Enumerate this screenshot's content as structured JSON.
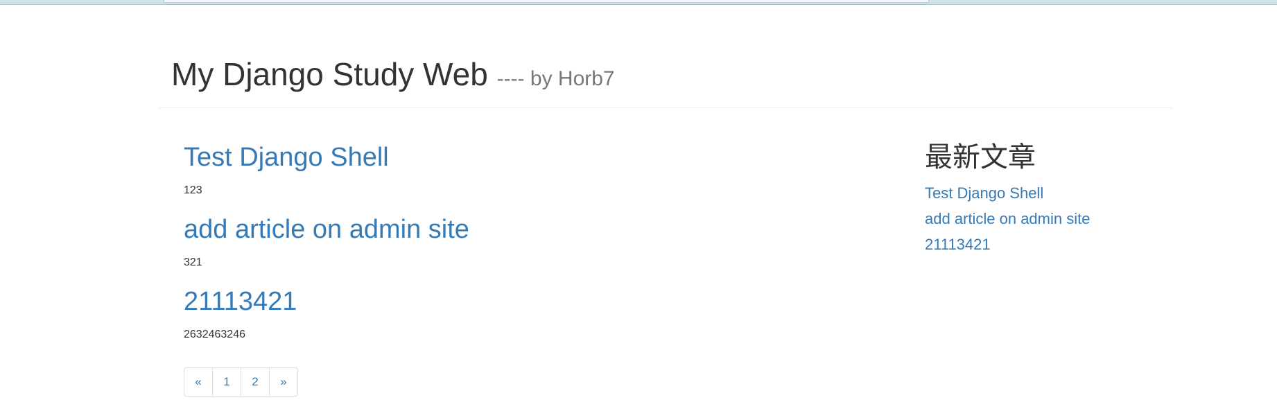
{
  "header": {
    "title": "My Django Study Web",
    "subtitle": "---- by Horb7"
  },
  "articles": [
    {
      "title": "Test Django Shell",
      "body": "123"
    },
    {
      "title": "add article on admin site",
      "body": "321"
    },
    {
      "title": "21113421",
      "body": "2632463246"
    }
  ],
  "pagination": {
    "prev": "«",
    "pages": [
      "1",
      "2"
    ],
    "next": "»"
  },
  "sidebar": {
    "heading": "最新文章",
    "links": [
      "Test Django Shell",
      "add article on admin site",
      "21113421"
    ]
  },
  "colors": {
    "link": "#337ab7",
    "text": "#333333",
    "muted": "#777777"
  }
}
